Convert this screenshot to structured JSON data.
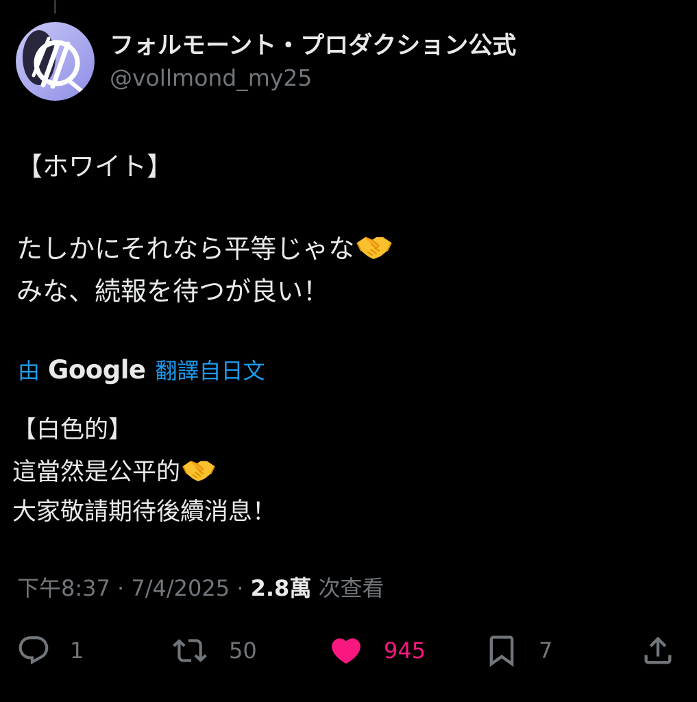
{
  "author": {
    "display_name": "フォルモーント・プロダクション公式",
    "handle": "@vollmond_my25",
    "avatar_icon": "logo-avatar-icon"
  },
  "tweet": {
    "line1": "【ホワイト】",
    "line2": "たしかにそれなら平等じゃな",
    "line3": "みな、続報を待つが良い！",
    "emoji": "handshake-emoji"
  },
  "translation": {
    "by_label": "由",
    "provider": "Google",
    "from_label": "翻譯自日文",
    "line1": "【白色的】",
    "line2": "這當然是公平的",
    "line3": "大家敬請期待後續消息！"
  },
  "meta": {
    "time": "下午8:37",
    "separator": " · ",
    "date": "7/4/2025",
    "views_count": "2.8萬",
    "views_label": " 次查看"
  },
  "actions": {
    "reply_count": "1",
    "retweet_count": "50",
    "like_count": "945",
    "bookmark_count": "7"
  },
  "colors": {
    "background": "#000000",
    "text_primary": "#e7e9ea",
    "text_secondary": "#71767b",
    "accent_link": "#1d9bf0",
    "like_pink": "#f91880"
  }
}
